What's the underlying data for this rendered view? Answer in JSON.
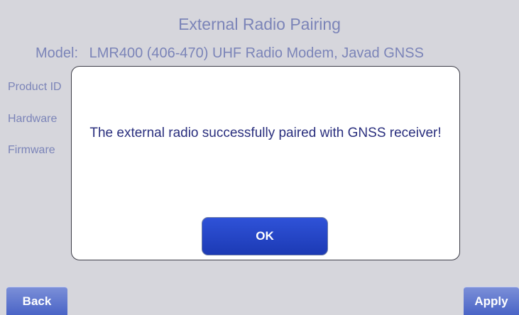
{
  "page": {
    "title": "External Radio Pairing",
    "model_label": "Model:",
    "model_value": "LMR400 (406-470) UHF Radio Modem, Javad GNSS",
    "info_labels": [
      "Product ID",
      "Hardware",
      "Firmware"
    ]
  },
  "dialog": {
    "message": "The external radio successfully paired with GNSS receiver!",
    "ok_label": "OK"
  },
  "footer": {
    "back_label": "Back",
    "apply_label": "Apply"
  }
}
